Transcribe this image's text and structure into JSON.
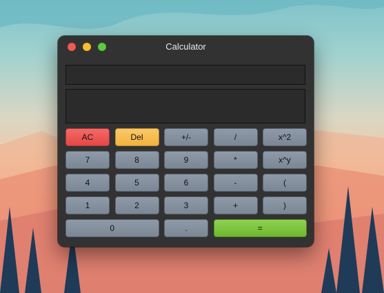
{
  "window": {
    "title": "Calculator"
  },
  "display": {
    "expression": "",
    "result": ""
  },
  "keys": {
    "ac": "AC",
    "del": "Del",
    "negate": "+/-",
    "divide": "/",
    "square": "x^2",
    "seven": "7",
    "eight": "8",
    "nine": "9",
    "multiply": "*",
    "power": "x^y",
    "four": "4",
    "five": "5",
    "six": "6",
    "minus": "-",
    "lparen": "(",
    "one": "1",
    "two": "2",
    "three": "3",
    "plus": "+",
    "rparen": ")",
    "zero": "0",
    "dot": ".",
    "equals": "="
  },
  "colors": {
    "clear_key": "#e95553",
    "delete_key": "#f5bd4d",
    "equals_key": "#78c03a",
    "default_key": "#8491a0",
    "window_bg": "#323232"
  }
}
